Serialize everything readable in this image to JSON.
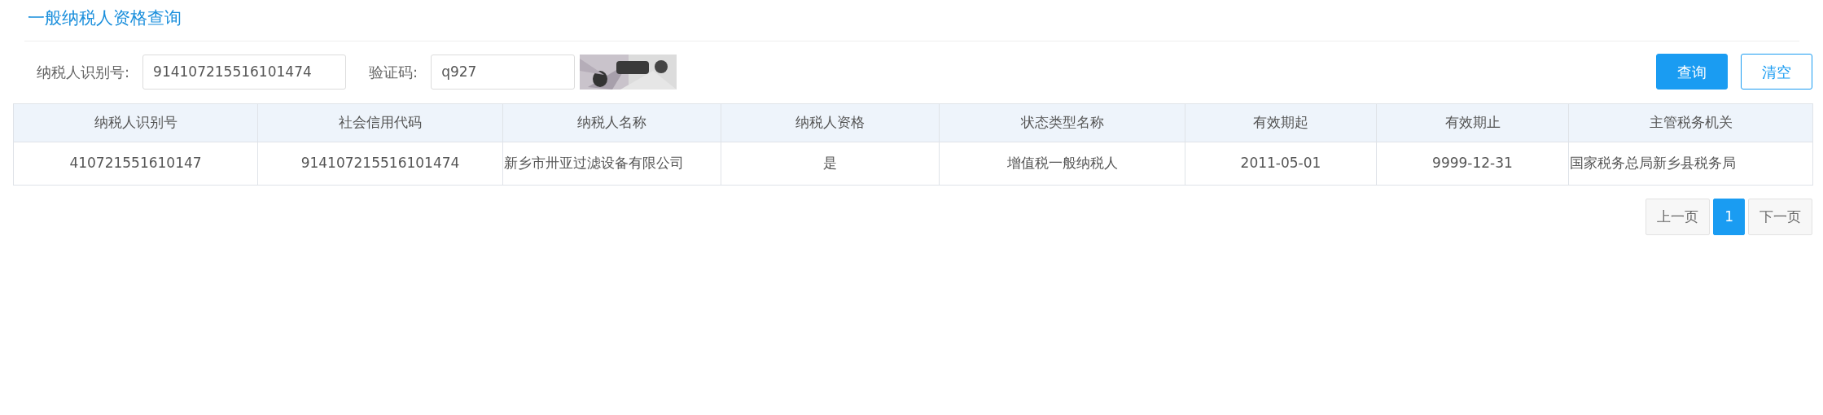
{
  "title": "一般纳税人资格查询",
  "form": {
    "taxpayer_id_label": "纳税人识别号:",
    "taxpayer_id_value": "914107215516101474",
    "captcha_label": "验证码:",
    "captcha_value": "q927"
  },
  "buttons": [
    {
      "label": "查询",
      "kind": "primary"
    },
    {
      "label": "清空",
      "kind": "outline"
    }
  ],
  "table": {
    "columns": [
      "纳税人识别号",
      "社会信用代码",
      "纳税人名称",
      "纳税人资格",
      "状态类型名称",
      "有效期起",
      "有效期止",
      "主管税务机关"
    ],
    "rows": [
      [
        "410721551610147",
        "914107215516101474",
        "新乡市卅亚过滤设备有限公司",
        "是",
        "增值税一般纳税人",
        "2011-05-01",
        "9999-12-31",
        "国家税务总局新乡县税务局"
      ]
    ]
  },
  "pagination": {
    "prev": "上一页",
    "next": "下一页",
    "pages": [
      {
        "label": "1",
        "selected": true
      }
    ]
  }
}
